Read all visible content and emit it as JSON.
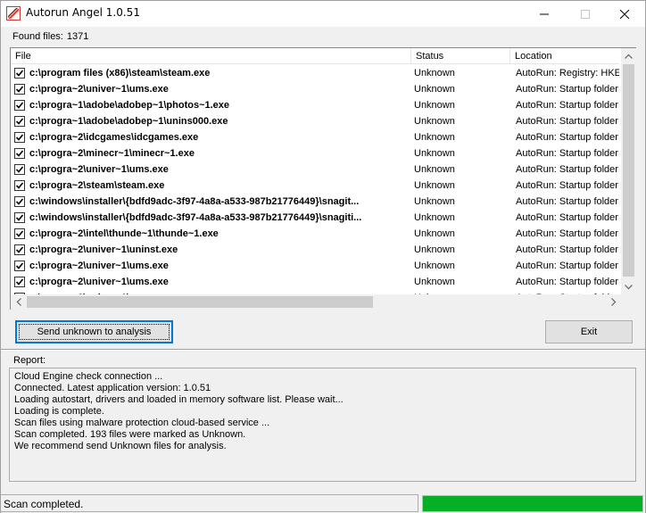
{
  "window": {
    "title": "Autorun Angel 1.0.51",
    "icon": "autorun-angel-app-icon",
    "controls": [
      "minimize-icon",
      "maximize-icon",
      "close-icon"
    ]
  },
  "found": {
    "label": "Found files:",
    "count": "1371"
  },
  "table": {
    "columns": [
      "File",
      "Status",
      "Location"
    ],
    "rows": [
      {
        "checked": true,
        "file": "c:\\program files (x86)\\steam\\steam.exe",
        "status": "Unknown",
        "location": "AutoRun: Registry: HKE"
      },
      {
        "checked": true,
        "file": "c:\\progra~2\\univer~1\\ums.exe",
        "status": "Unknown",
        "location": "AutoRun: Startup folder"
      },
      {
        "checked": true,
        "file": "c:\\progra~1\\adobe\\adobep~1\\photos~1.exe",
        "status": "Unknown",
        "location": "AutoRun: Startup folder"
      },
      {
        "checked": true,
        "file": "c:\\progra~1\\adobe\\adobep~1\\unins000.exe",
        "status": "Unknown",
        "location": "AutoRun: Startup folder"
      },
      {
        "checked": true,
        "file": "c:\\progra~2\\idcgames\\idcgames.exe",
        "status": "Unknown",
        "location": "AutoRun: Startup folder"
      },
      {
        "checked": true,
        "file": "c:\\progra~2\\minecr~1\\minecr~1.exe",
        "status": "Unknown",
        "location": "AutoRun: Startup folder"
      },
      {
        "checked": true,
        "file": "c:\\progra~2\\univer~1\\ums.exe",
        "status": "Unknown",
        "location": "AutoRun: Startup folder"
      },
      {
        "checked": true,
        "file": "c:\\progra~2\\steam\\steam.exe",
        "status": "Unknown",
        "location": "AutoRun: Startup folder"
      },
      {
        "checked": true,
        "file": "c:\\windows\\installer\\{bdfd9adc-3f97-4a8a-a533-987b21776449}\\snagit...",
        "status": "Unknown",
        "location": "AutoRun: Startup folder"
      },
      {
        "checked": true,
        "file": "c:\\windows\\installer\\{bdfd9adc-3f97-4a8a-a533-987b21776449}\\snagiti...",
        "status": "Unknown",
        "location": "AutoRun: Startup folder"
      },
      {
        "checked": true,
        "file": "c:\\progra~2\\intel\\thunde~1\\thunde~1.exe",
        "status": "Unknown",
        "location": "AutoRun: Startup folder"
      },
      {
        "checked": true,
        "file": "c:\\progra~2\\univer~1\\uninst.exe",
        "status": "Unknown",
        "location": "AutoRun: Startup folder"
      },
      {
        "checked": true,
        "file": "c:\\progra~2\\univer~1\\ums.exe",
        "status": "Unknown",
        "location": "AutoRun: Startup folder"
      },
      {
        "checked": true,
        "file": "c:\\progra~2\\univer~1\\ums.exe",
        "status": "Unknown",
        "location": "AutoRun: Startup folder"
      },
      {
        "checked": true,
        "file": "c:\\progra~2\\univer~1\\ums.exe",
        "status": "Unknown",
        "location": "AutoRun: Startup folder"
      }
    ]
  },
  "buttons": {
    "send_label": "Send unknown to analysis",
    "exit_label": "Exit"
  },
  "report": {
    "label": "Report:",
    "lines": [
      "Cloud Engine check connection ...",
      "Connected. Latest application version: 1.0.51",
      "Loading autostart, drivers and loaded in memory software list. Please wait...",
      "Loading is complete.",
      "Scan files using malware protection cloud-based service ...",
      "Scan completed.  193 files were marked as Unknown.",
      "We recommend send Unknown files for analysis."
    ]
  },
  "statusbar": {
    "text": "Scan completed.",
    "progress_percent": 100,
    "progress_color": "#06b025"
  },
  "colors": {
    "accent": "#0078d7"
  }
}
